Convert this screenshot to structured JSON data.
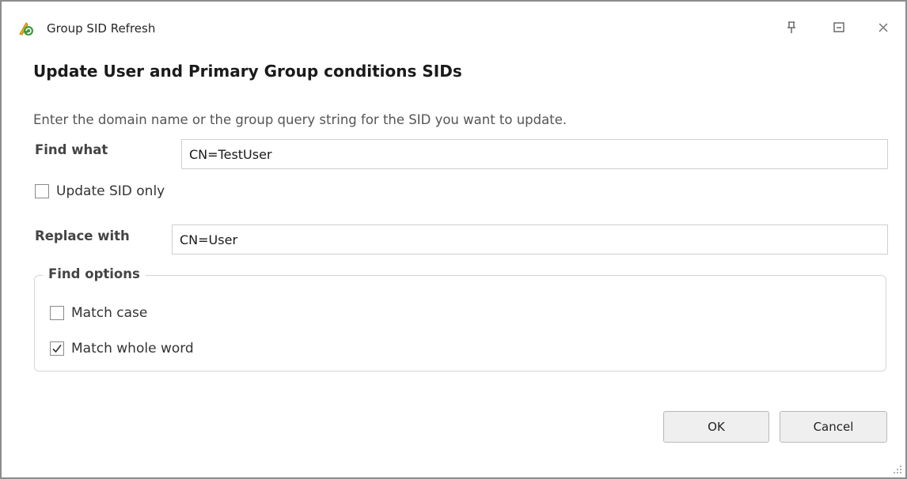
{
  "window": {
    "title": "Group SID Refresh",
    "controls": [
      "pin-icon",
      "maximize-icon",
      "close-icon"
    ]
  },
  "dialog": {
    "heading": "Update User and Primary Group conditions SIDs",
    "description": "Enter the domain name or the group query string for the SID you want to update.",
    "find_label": "Find what",
    "find_value": "CN=TestUser",
    "update_sid_only": {
      "label": "Update SID only",
      "checked": false
    },
    "replace_label": "Replace with",
    "replace_value": "CN=User",
    "find_options": {
      "title": "Find options",
      "match_case": {
        "label": "Match case",
        "checked": false
      },
      "match_whole_word": {
        "label": "Match whole word",
        "checked": true
      }
    }
  },
  "buttons": {
    "ok": "OK",
    "cancel": "Cancel"
  },
  "colors": {
    "border": "#8c8c8c",
    "icon_green": "#3c9a3c",
    "icon_yellow": "#e6b422"
  }
}
